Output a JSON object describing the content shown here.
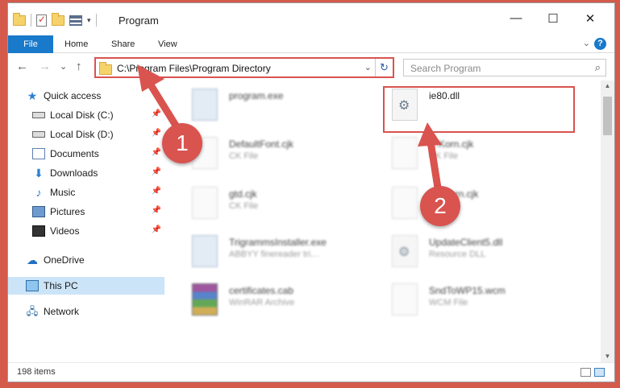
{
  "window": {
    "title": "Program",
    "minimize_glyph": "—",
    "maximize_glyph": "☐",
    "close_glyph": "✕"
  },
  "ribbon": {
    "tabs": [
      "File",
      "Home",
      "Share",
      "View"
    ],
    "help_glyph": "?",
    "expand_glyph": "⌄"
  },
  "nav": {
    "back_glyph": "←",
    "forward_glyph": "→",
    "recent_glyph": "⌄",
    "up_glyph": "↑"
  },
  "address": {
    "path": "C:\\Program Files\\Program Directory",
    "dropdown_glyph": "⌄",
    "refresh_glyph": "↻"
  },
  "search": {
    "placeholder": "Search Program",
    "icon_glyph": "⌕"
  },
  "sidebar": {
    "items": [
      {
        "label": "Quick access",
        "icon": "star-icon",
        "pinned": false
      },
      {
        "label": "Local Disk (C:)",
        "icon": "local-disk-icon",
        "pinned": true
      },
      {
        "label": "Local Disk (D:)",
        "icon": "local-disk-icon",
        "pinned": true
      },
      {
        "label": "Documents",
        "icon": "documents-icon",
        "pinned": true
      },
      {
        "label": "Downloads",
        "icon": "downloads-icon",
        "pinned": true
      },
      {
        "label": "Music",
        "icon": "music-icon",
        "pinned": true
      },
      {
        "label": "Pictures",
        "icon": "pictures-icon",
        "pinned": true
      },
      {
        "label": "Videos",
        "icon": "videos-icon",
        "pinned": true
      },
      {
        "label": "OneDrive",
        "icon": "onedrive-icon",
        "pinned": false
      },
      {
        "label": "This PC",
        "icon": "this-pc-icon",
        "pinned": false,
        "selected": true
      },
      {
        "label": "Network",
        "icon": "network-icon",
        "pinned": false
      }
    ],
    "pin_glyph": "📌"
  },
  "files": [
    {
      "name": "program.exe",
      "type": "",
      "icon": "exe-icon",
      "blurred": true
    },
    {
      "name": "ie80.dll",
      "type": "",
      "icon": "dll-icon",
      "blurred": false,
      "highlighted": true
    },
    {
      "name": "DefaultFont.cjk",
      "type": "CK File",
      "icon": "file-icon",
      "blurred": true
    },
    {
      "name": "…Korn.cjk",
      "type": "CK File",
      "icon": "file-icon",
      "blurred": true
    },
    {
      "name": "gtd.cjk",
      "type": "CK File",
      "icon": "file-icon",
      "blurred": true
    },
    {
      "name": "Fa…orn.cjk",
      "type": "",
      "icon": "file-icon",
      "blurred": true
    },
    {
      "name": "TrigrammsInstaller.exe",
      "type": "ABBYY finereader tri…",
      "icon": "exe-icon",
      "blurred": true
    },
    {
      "name": "UpdateClient5.dll",
      "type": "Resource DLL",
      "icon": "dll-icon",
      "blurred": true
    },
    {
      "name": "certificates.cab",
      "type": "WinRAR Archive",
      "icon": "rar-icon",
      "blurred": true
    },
    {
      "name": "SndToWP15.wcm",
      "type": "WCM File",
      "icon": "file-icon",
      "blurred": true
    }
  ],
  "status": {
    "item_count": "198 items"
  },
  "annotations": {
    "step1": "1",
    "step2": "2",
    "color": "#d9534f"
  }
}
